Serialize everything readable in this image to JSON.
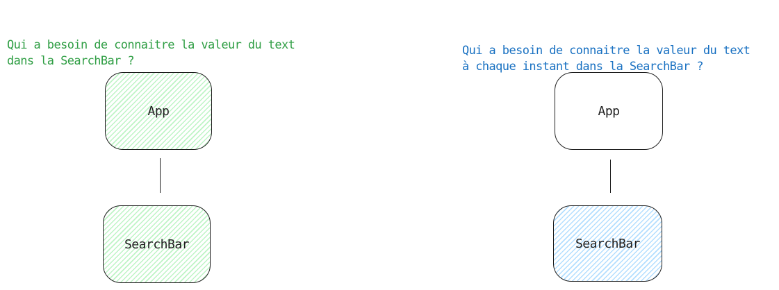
{
  "colors": {
    "left_question": "#2f9e44",
    "right_question": "#1971c2",
    "stroke": "#1e1e1e",
    "green_fill": "#b2f2bb",
    "blue_fill": "#a5d8ff"
  },
  "left": {
    "question_lines": [
      "Qui a besoin de connaitre la valeur du text",
      "dans la SearchBar ?"
    ],
    "top_node": {
      "label": "App",
      "fill": "green"
    },
    "bottom_node": {
      "label": "SearchBar",
      "fill": "green"
    }
  },
  "right": {
    "question_lines": [
      "Qui a besoin de connaitre la valeur du text",
      "à chaque instant dans la SearchBar ?"
    ],
    "top_node": {
      "label": "App",
      "fill": "none"
    },
    "bottom_node": {
      "label": "SearchBar",
      "fill": "blue"
    }
  }
}
